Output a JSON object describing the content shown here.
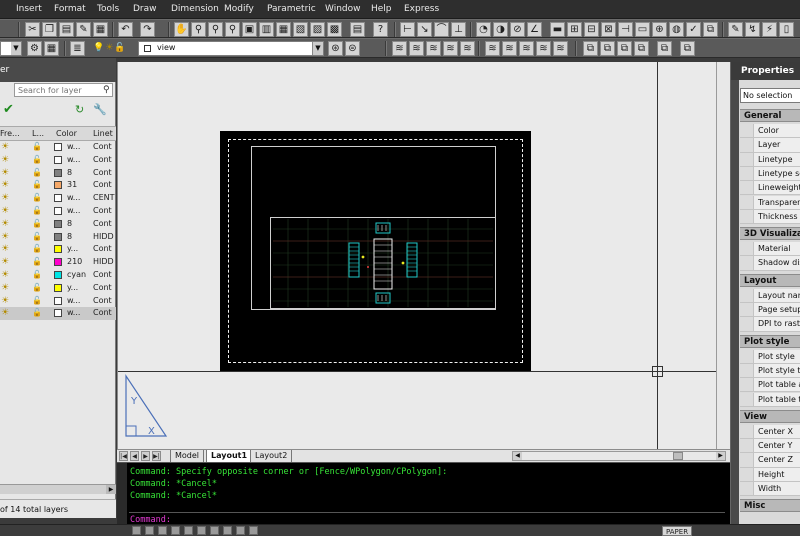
{
  "menubar": {
    "items": [
      "Insert",
      "Format",
      "Tools",
      "Draw",
      "Dimension",
      "Modify",
      "Parametric",
      "Window",
      "Help",
      "Express"
    ]
  },
  "toolbar": {
    "layer_combo_value": "view"
  },
  "layer_palette": {
    "title": "er",
    "search_placeholder": "Search for layer",
    "columns": [
      "Fre...",
      "L...",
      "Color",
      "Linet"
    ],
    "rows": [
      {
        "color_name": "w...",
        "swatch": "#ffffff",
        "linetype": "Cont"
      },
      {
        "color_name": "w...",
        "swatch": "#ffffff",
        "linetype": "Cont"
      },
      {
        "color_name": "8",
        "swatch": "#808080",
        "linetype": "Cont"
      },
      {
        "color_name": "31",
        "swatch": "#f5a868",
        "linetype": "Cont"
      },
      {
        "color_name": "w...",
        "swatch": "#ffffff",
        "linetype": "CENT"
      },
      {
        "color_name": "w...",
        "swatch": "#ffffff",
        "linetype": "Cont"
      },
      {
        "color_name": "8",
        "swatch": "#808080",
        "linetype": "Cont"
      },
      {
        "color_name": "8",
        "swatch": "#808080",
        "linetype": "HIDD"
      },
      {
        "color_name": "y...",
        "swatch": "#ffff00",
        "linetype": "Cont"
      },
      {
        "color_name": "210",
        "swatch": "#ff00cc",
        "linetype": "HIDD"
      },
      {
        "color_name": "cyan",
        "swatch": "#00e5e5",
        "linetype": "Cont"
      },
      {
        "color_name": "y...",
        "swatch": "#ffff00",
        "linetype": "Cont"
      },
      {
        "color_name": "w...",
        "swatch": "#ffffff",
        "linetype": "Cont"
      },
      {
        "color_name": "w...",
        "swatch": "#ffffff",
        "linetype": "Cont"
      }
    ],
    "status": "of 14 total layers"
  },
  "tabs": [
    "Model",
    "Layout1",
    "Layout2"
  ],
  "active_tab": "Layout1",
  "command_window": {
    "lines": [
      "Command: Specify opposite corner or [Fence/WPolygon/CPolygon]:",
      "Command: *Cancel*",
      "Command: *Cancel*"
    ],
    "prompt": "Command:"
  },
  "statusbar": {
    "paper_label": "PAPER"
  },
  "properties": {
    "title": "Properties",
    "selection": "No selection",
    "sections": [
      {
        "name": "General",
        "rows": [
          "Color",
          "Layer",
          "Linetype",
          "Linetype sc",
          "Lineweight",
          "Transparen",
          "Thickness"
        ]
      },
      {
        "name": "3D Visualizat",
        "rows": [
          "Material",
          "Shadow dis"
        ]
      },
      {
        "name": "Layout",
        "rows": [
          "Layout nam",
          "Page setup",
          "DPI to raste"
        ]
      },
      {
        "name": "Plot style",
        "rows": [
          "Plot style",
          "Plot style ta",
          "Plot table a",
          "Plot table ty"
        ]
      },
      {
        "name": "View",
        "rows": [
          "Center X",
          "Center Y",
          "Center Z",
          "Height",
          "Width"
        ]
      },
      {
        "name": "Misc",
        "rows": []
      }
    ]
  },
  "colors": {
    "command_text": "#37e437",
    "prompt_text": "#e43ad4",
    "drawing_bg": "#000000"
  }
}
